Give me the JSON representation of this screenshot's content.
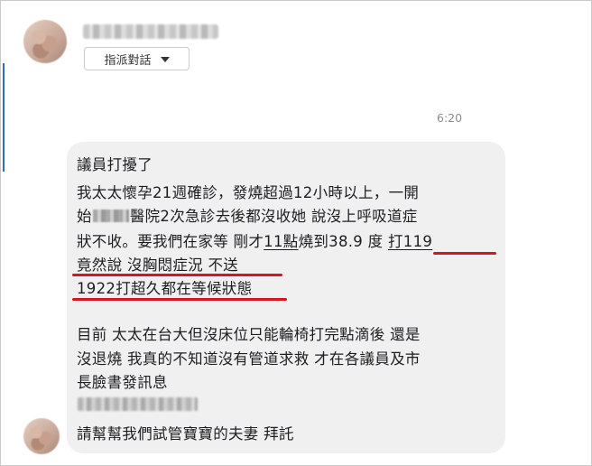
{
  "header": {
    "assign_label": "指派對話"
  },
  "message": {
    "time": "6:20",
    "lines": {
      "l1": "議員打擾了",
      "l2": "我太太懷孕21週確診，發燒超過12小時以上，一開",
      "l3a": "始",
      "l3b": "醫院2次急診去後都沒收她 說沒上呼吸道症",
      "l4a": "狀不收。要我們在家等 剛才",
      "l4b": "11點",
      "l4c": "燒到38.9 度 ",
      "l4d": "打119",
      "l5": "竟然說 沒胸悶症況 不送",
      "l6": "1922打超久都在等候狀態",
      "l7": "目前 太太在台大但沒床位只能輪椅打完點滴後 還是",
      "l8": "沒退燒 我真的不知道沒有管道求救 才在各議員及市",
      "l9": "長臉書發訊息",
      "l10": "請幫幫我們試管寶寶的夫妻 拜託"
    }
  },
  "colors": {
    "highlight": "#d9141e",
    "bubble": "#f0f0f0"
  }
}
